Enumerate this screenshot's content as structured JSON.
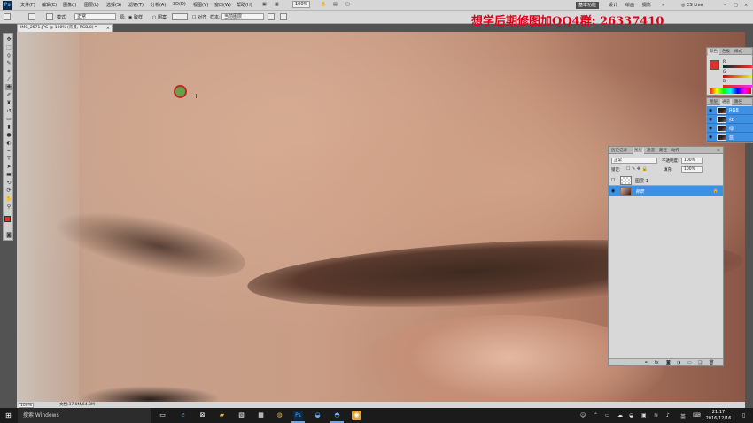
{
  "menubar": {
    "logo": "Ps",
    "items": [
      "文件(F)",
      "编辑(E)",
      "图像(I)",
      "图层(L)",
      "选择(S)",
      "滤镜(T)",
      "分析(A)",
      "3D(D)",
      "视图(V)",
      "窗口(W)",
      "帮助(H)"
    ],
    "zoom_value": "100%",
    "workspaces": [
      "基本功能",
      "设计",
      "绘画",
      "摄影"
    ],
    "more": "»",
    "cslive": "CS Live"
  },
  "options": {
    "mode_label": "模式:",
    "mode_value": "正常",
    "source_label": "源:",
    "source_sampled": "取样",
    "source_pattern": "图案:",
    "aligned_label": "对齐",
    "sample_label": "样本:",
    "sample_value": "当前图层"
  },
  "watermark": "想学后期修图加QQ4群: 26337410",
  "document": {
    "tab_title": "IMG_2571.JPG @ 100% (背景, RGB/8) *",
    "close": "×"
  },
  "status": {
    "zoom": "100%",
    "doc_info": "文档:37.0M/64.3M"
  },
  "color_panel": {
    "tabs": [
      "颜色",
      "色板",
      "样式"
    ],
    "fg_color": "#e32d2d",
    "channels": [
      "R",
      "G",
      "B"
    ]
  },
  "channels_panel": {
    "tabs": [
      "图层",
      "通道",
      "路径"
    ],
    "rows": [
      "RGB",
      "红",
      "绿",
      "蓝"
    ]
  },
  "layers_panel": {
    "tabs": [
      "历史记录",
      "图层",
      "通道",
      "路径",
      "动作"
    ],
    "blend_mode": "正常",
    "opacity_label": "不透明度:",
    "opacity_value": "100%",
    "lock_label": "锁定:",
    "fill_label": "填充:",
    "fill_value": "100%",
    "layers": [
      {
        "name": "图层 1",
        "visible": false,
        "selected": false
      },
      {
        "name": "背景",
        "visible": true,
        "selected": true
      }
    ],
    "footer_icons": [
      "link-icon",
      "fx-icon",
      "mask-icon",
      "adjustment-icon",
      "group-icon",
      "new-layer-icon",
      "trash-icon"
    ]
  },
  "taskbar": {
    "search_placeholder": "搜索 Windows",
    "tray_lang": "英",
    "time": "21:17",
    "date": "2016/12/16"
  }
}
